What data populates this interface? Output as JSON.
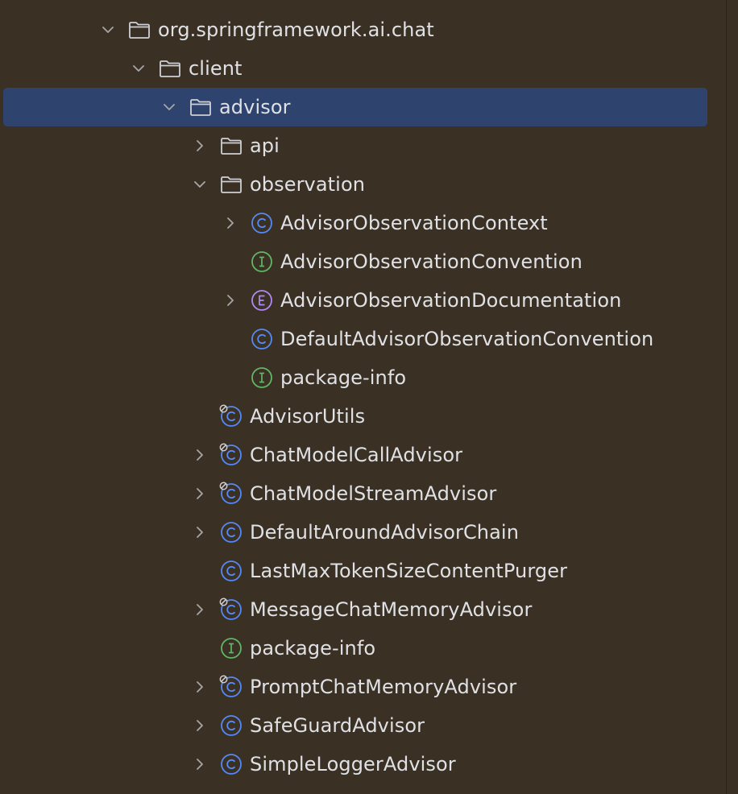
{
  "colors": {
    "background": "#3b3024",
    "selection": "#2e436e",
    "text": "#dfe1e5",
    "chevron": "#a5a7ab",
    "class_icon": "#548af7",
    "interface_icon": "#5fb865",
    "enum_icon": "#b189f5",
    "folder_icon": "#ced0d6"
  },
  "tree": [
    {
      "label": "org.springframework.ai.chat",
      "icon": "folder-icon",
      "chevron": "down",
      "level": 0
    },
    {
      "label": "client",
      "icon": "folder-icon",
      "chevron": "down",
      "level": 1
    },
    {
      "label": "advisor",
      "icon": "folder-icon",
      "chevron": "down",
      "level": 2,
      "selected": true
    },
    {
      "label": "api",
      "icon": "folder-icon",
      "chevron": "right",
      "level": 3
    },
    {
      "label": "observation",
      "icon": "folder-icon",
      "chevron": "down",
      "level": 3
    },
    {
      "label": "AdvisorObservationContext",
      "icon": "class-icon",
      "chevron": "right",
      "level": 4
    },
    {
      "label": "AdvisorObservationConvention",
      "icon": "interface-icon",
      "chevron": "none",
      "level": 4
    },
    {
      "label": "AdvisorObservationDocumentation",
      "icon": "enum-icon",
      "chevron": "right",
      "level": 4
    },
    {
      "label": "DefaultAdvisorObservationConvention",
      "icon": "class-icon",
      "chevron": "none",
      "level": 4
    },
    {
      "label": "package-info",
      "icon": "interface-icon",
      "chevron": "none",
      "level": 4
    },
    {
      "label": "AdvisorUtils",
      "icon": "final-class-icon",
      "chevron": "none",
      "level": 3
    },
    {
      "label": "ChatModelCallAdvisor",
      "icon": "final-class-icon",
      "chevron": "right",
      "level": 3
    },
    {
      "label": "ChatModelStreamAdvisor",
      "icon": "final-class-icon",
      "chevron": "right",
      "level": 3
    },
    {
      "label": "DefaultAroundAdvisorChain",
      "icon": "class-icon",
      "chevron": "right",
      "level": 3
    },
    {
      "label": "LastMaxTokenSizeContentPurger",
      "icon": "class-icon",
      "chevron": "none",
      "level": 3
    },
    {
      "label": "MessageChatMemoryAdvisor",
      "icon": "final-class-icon",
      "chevron": "right",
      "level": 3
    },
    {
      "label": "package-info",
      "icon": "interface-icon",
      "chevron": "none",
      "level": 3
    },
    {
      "label": "PromptChatMemoryAdvisor",
      "icon": "final-class-icon",
      "chevron": "right",
      "level": 3
    },
    {
      "label": "SafeGuardAdvisor",
      "icon": "class-icon",
      "chevron": "right",
      "level": 3
    },
    {
      "label": "SimpleLoggerAdvisor",
      "icon": "class-icon",
      "chevron": "right",
      "level": 3
    }
  ]
}
